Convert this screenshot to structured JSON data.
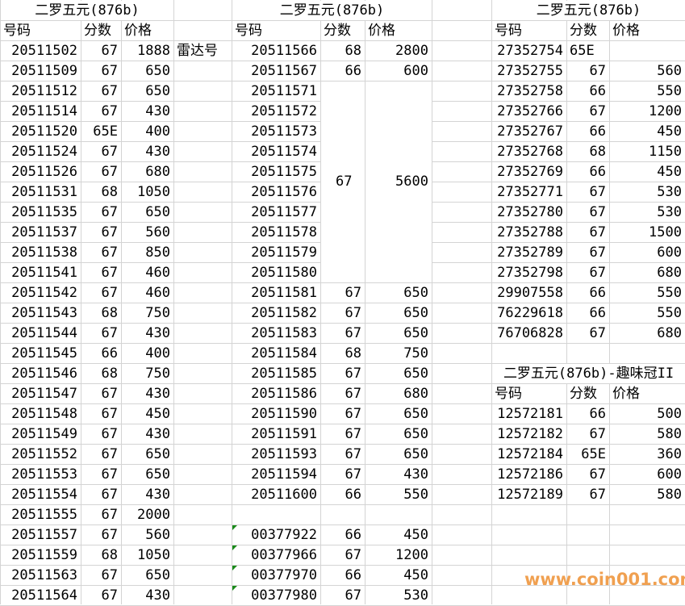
{
  "section1": {
    "title": "二罗五元(876b)",
    "headers": [
      "号码",
      "分数",
      "价格"
    ],
    "rows": [
      [
        "20511502",
        "67",
        "1888"
      ],
      [
        "20511509",
        "67",
        "650"
      ],
      [
        "20511512",
        "67",
        "650"
      ],
      [
        "20511514",
        "67",
        "430"
      ],
      [
        "20511520",
        "65E",
        "400"
      ],
      [
        "20511524",
        "67",
        "430"
      ],
      [
        "20511526",
        "67",
        "680"
      ],
      [
        "20511531",
        "68",
        "1050"
      ],
      [
        "20511535",
        "67",
        "650"
      ],
      [
        "20511537",
        "67",
        "560"
      ],
      [
        "20511538",
        "67",
        "850"
      ],
      [
        "20511541",
        "67",
        "460"
      ],
      [
        "20511542",
        "67",
        "460"
      ],
      [
        "20511543",
        "68",
        "750"
      ],
      [
        "20511544",
        "67",
        "430"
      ],
      [
        "20511545",
        "66",
        "400"
      ],
      [
        "20511546",
        "68",
        "750"
      ],
      [
        "20511547",
        "67",
        "430"
      ],
      [
        "20511548",
        "67",
        "450"
      ],
      [
        "20511549",
        "67",
        "430"
      ],
      [
        "20511552",
        "67",
        "650"
      ],
      [
        "20511553",
        "67",
        "650"
      ],
      [
        "20511554",
        "67",
        "430"
      ],
      [
        "20511555",
        "67",
        "2000"
      ],
      [
        "20511557",
        "67",
        "560"
      ],
      [
        "20511559",
        "68",
        "1050"
      ],
      [
        "20511563",
        "67",
        "650"
      ],
      [
        "20511564",
        "67",
        "430"
      ]
    ]
  },
  "radar_label": "雷达号",
  "section2": {
    "title": "二罗五元(876b)",
    "headers": [
      "号码",
      "分数",
      "价格"
    ],
    "rows_top": [
      [
        "20511566",
        "68",
        "2800"
      ],
      [
        "20511567",
        "66",
        "600"
      ]
    ],
    "merged_numbers": [
      "20511571",
      "20511572",
      "20511573",
      "20511574",
      "20511575",
      "20511576",
      "20511577",
      "20511578",
      "20511579",
      "20511580"
    ],
    "merged_score": "67",
    "merged_price": "5600",
    "rows_bottom": [
      [
        "20511581",
        "67",
        "650"
      ],
      [
        "20511582",
        "67",
        "650"
      ],
      [
        "20511583",
        "67",
        "650"
      ],
      [
        "20511584",
        "68",
        "750"
      ],
      [
        "20511585",
        "67",
        "650"
      ],
      [
        "20511586",
        "67",
        "680"
      ],
      [
        "20511590",
        "67",
        "650"
      ],
      [
        "20511591",
        "67",
        "650"
      ],
      [
        "20511593",
        "67",
        "650"
      ],
      [
        "20511594",
        "67",
        "430"
      ],
      [
        "20511600",
        "66",
        "550"
      ]
    ],
    "rows_extra": [
      [
        "00377922",
        "66",
        "450"
      ],
      [
        "00377966",
        "67",
        "1200"
      ],
      [
        "00377970",
        "66",
        "450"
      ],
      [
        "00377980",
        "67",
        "530"
      ]
    ]
  },
  "section3": {
    "title": "二罗五元(876b)",
    "headers": [
      "号码",
      "分数",
      "价格"
    ],
    "rows": [
      [
        "27352754",
        "65E",
        ""
      ],
      [
        "27352755",
        "67",
        "560"
      ],
      [
        "27352758",
        "66",
        "550"
      ],
      [
        "27352766",
        "67",
        "1200"
      ],
      [
        "27352767",
        "66",
        "450"
      ],
      [
        "27352768",
        "68",
        "1150"
      ],
      [
        "27352769",
        "66",
        "450"
      ],
      [
        "27352771",
        "67",
        "530"
      ],
      [
        "27352780",
        "67",
        "530"
      ],
      [
        "27352788",
        "67",
        "1500"
      ],
      [
        "27352789",
        "67",
        "600"
      ],
      [
        "27352798",
        "67",
        "680"
      ],
      [
        "29907558",
        "66",
        "550"
      ],
      [
        "76229618",
        "66",
        "550"
      ],
      [
        "76706828",
        "67",
        "680"
      ]
    ]
  },
  "section4": {
    "title": "二罗五元(876b)-趣味冠II",
    "headers": [
      "号码",
      "分数",
      "价格"
    ],
    "rows": [
      [
        "12572181",
        "66",
        "500"
      ],
      [
        "12572182",
        "67",
        "580"
      ],
      [
        "12572184",
        "65E",
        "360"
      ],
      [
        "12572186",
        "67",
        "600"
      ],
      [
        "12572189",
        "67",
        "580"
      ]
    ]
  },
  "watermark": "www.coin001.com",
  "colors": {
    "grid": "#d4d4d4",
    "text_marker": "#1a8a1a",
    "watermark": "#f0a050"
  }
}
